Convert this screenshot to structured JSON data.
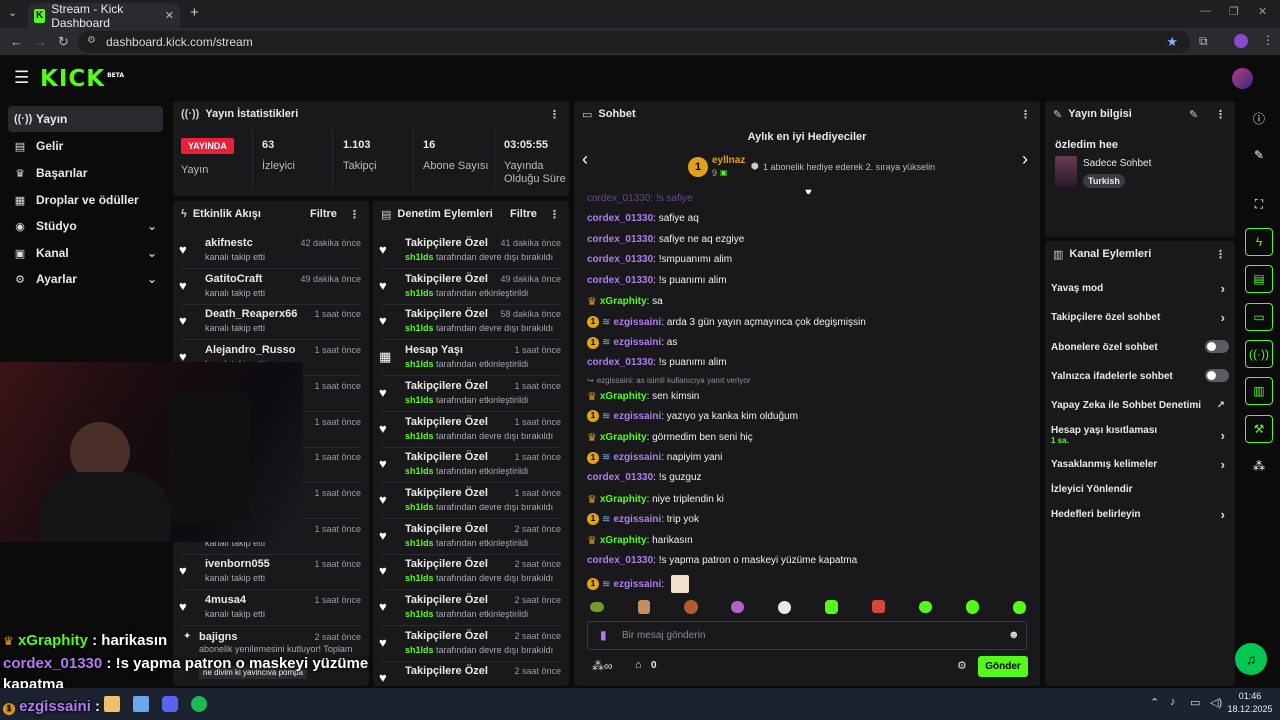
{
  "browser": {
    "tab_title": "Stream - Kick Dashboard",
    "url": "dashboard.kick.com/stream"
  },
  "header": {
    "logo": "KICK",
    "logo_badge": "BETA"
  },
  "sidebar": {
    "items": [
      {
        "label": "Yayın",
        "icon": "broadcast-icon"
      },
      {
        "label": "Gelir",
        "icon": "revenue-icon"
      },
      {
        "label": "Başarılar",
        "icon": "trophy-icon"
      },
      {
        "label": "Droplar ve ödüller",
        "icon": "gift-icon"
      },
      {
        "label": "Stüdyo",
        "icon": "studio-icon"
      },
      {
        "label": "Kanal",
        "icon": "channel-icon"
      },
      {
        "label": "Ayarlar",
        "icon": "gear-icon"
      }
    ]
  },
  "stats": {
    "title": "Yayın İstatistikleri",
    "live_badge": "YAYINDA",
    "live_label": "Yayın",
    "items": [
      {
        "value": "63",
        "label": "İzleyici"
      },
      {
        "value": "1.103",
        "label": "Takipçi"
      },
      {
        "value": "16",
        "label": "Abone Sayısı"
      },
      {
        "value": "03:05:55",
        "label": "Yayında Olduğu Süre"
      }
    ]
  },
  "activity": {
    "title": "Etkinlik Akışı",
    "filter": "Filtre",
    "items": [
      {
        "name": "akifnestc",
        "sub": "kanalı takip etti",
        "time": "42 dakika önce"
      },
      {
        "name": "GatitoCraft",
        "sub": "kanalı takip etti",
        "time": "49 dakika önce"
      },
      {
        "name": "Death_Reaperx66",
        "sub": "kanalı takip etti",
        "time": "1 saat önce"
      },
      {
        "name": "Alejandro_Russo",
        "sub": "kanalı takip etti",
        "time": "1 saat önce"
      },
      {
        "name": "",
        "sub": "",
        "time": "1 saat önce"
      },
      {
        "name": "",
        "sub": "",
        "time": "1 saat önce"
      },
      {
        "name": "",
        "sub": "",
        "time": "1 saat önce"
      },
      {
        "name": "",
        "sub": "",
        "time": "1 saat önce"
      },
      {
        "name": "",
        "sub": "kanalı takip etti",
        "time": "1 saat önce"
      },
      {
        "name": "ivenborn055",
        "sub": "kanalı takip etti",
        "time": "1 saat önce"
      },
      {
        "name": "4musa4",
        "sub": "kanalı takip etti",
        "time": "1 saat önce"
      }
    ],
    "last": {
      "name": "bajigns",
      "time": "2 saat önce",
      "sub": "abonelik yenilemesini kutluyor! Toplam",
      "msg": "ne divim ki yavincıva pompa"
    }
  },
  "moderation": {
    "title": "Denetim Eylemleri",
    "filter": "Filtre",
    "items": [
      {
        "action": "Takipçilere Özel",
        "mod": "sh1lds",
        "detail": "tarafından devre dışı bırakıldı",
        "time": "41 dakika önce"
      },
      {
        "action": "Takipçilere Özel",
        "mod": "sh1lds",
        "detail": "tarafından etkinleştirildi",
        "time": "49 dakika önce"
      },
      {
        "action": "Takipçilere Özel",
        "mod": "sh1lds",
        "detail": "tarafından devre dışı bırakıldı",
        "time": "58 dakika önce"
      },
      {
        "action": "Hesap Yaşı",
        "mod": "sh1lds",
        "detail": "tarafından etkinleştirildi",
        "time": "1 saat önce"
      },
      {
        "action": "Takipçilere Özel",
        "mod": "sh1lds",
        "detail": "tarafından etkinleştirildi",
        "time": "1 saat önce"
      },
      {
        "action": "Takipçilere Özel",
        "mod": "sh1lds",
        "detail": "tarafından devre dışı bırakıldı",
        "time": "1 saat önce"
      },
      {
        "action": "Takipçilere Özel",
        "mod": "sh1lds",
        "detail": "tarafından etkinleştirildi",
        "time": "1 saat önce"
      },
      {
        "action": "Takipçilere Özel",
        "mod": "sh1lds",
        "detail": "tarafından devre dışı bırakıldı",
        "time": "1 saat önce"
      },
      {
        "action": "Takipçilere Özel",
        "mod": "sh1lds",
        "detail": "tarafından etkinleştirildi",
        "time": "2 saat önce"
      },
      {
        "action": "Takipçilere Özel",
        "mod": "sh1lds",
        "detail": "tarafından devre dışı bırakıldı",
        "time": "2 saat önce"
      },
      {
        "action": "Takipçilere Özel",
        "mod": "sh1lds",
        "detail": "tarafından etkinleştirildi",
        "time": "2 saat önce"
      },
      {
        "action": "Takipçilere Özel",
        "mod": "sh1lds",
        "detail": "tarafından devre dışı bırakıldı",
        "time": "2 saat önce"
      },
      {
        "action": "Takipçilere Özel",
        "mod": "",
        "detail": "",
        "time": "2 saat önce"
      }
    ]
  },
  "chat": {
    "title": "Sohbet",
    "gifters_title": "Aylık en iyi Hediyeciler",
    "top_gifter": {
      "rank": "1",
      "name": "eyllnaz",
      "count": "9"
    },
    "gifter_note": "1 abonelik hediye ederek 2. sıraya yükselin",
    "messages": [
      {
        "user": "cordex_01330",
        "text": ": safiye aq",
        "type": "plain"
      },
      {
        "user": "cordex_01330",
        "text": ": safiye ne aq ezgiye",
        "type": "plain"
      },
      {
        "user": "cordex_01330",
        "text": ": !smpuanımı alim",
        "type": "plain"
      },
      {
        "user": "cordex_01330",
        "text": ": !s puanımı alim",
        "type": "plain"
      },
      {
        "user": "xGraphity",
        "text": ": sa",
        "type": "crown"
      },
      {
        "user": "ezgissaini",
        "text": ": arda 3 gün yayın açmayınca çok degişmişsin",
        "type": "sub"
      },
      {
        "user": "ezgissaini",
        "text": ": as",
        "type": "sub"
      },
      {
        "user": "cordex_01330",
        "text": ": !s puanımı alim",
        "type": "plain"
      },
      {
        "user": "xGraphity",
        "text": ": sen kimsin",
        "type": "crown",
        "reply": "ezgissaini: as isimli kullanıcıya yanıt veriyor"
      },
      {
        "user": "ezgissaini",
        "text": ": yazıyo ya kanka kim olduğum",
        "type": "sub"
      },
      {
        "user": "xGraphity",
        "text": ": görmedim ben seni hiç",
        "type": "crown"
      },
      {
        "user": "ezgissaini",
        "text": ": napiyim yani",
        "type": "sub"
      },
      {
        "user": "cordex_01330",
        "text": ": !s guzguz",
        "type": "plain"
      },
      {
        "user": "xGraphity",
        "text": ": niye triplendin ki",
        "type": "crown"
      },
      {
        "user": "ezgissaini",
        "text": ": trip yok",
        "type": "sub"
      },
      {
        "user": "xGraphity",
        "text": ": harikasın",
        "type": "crown"
      },
      {
        "user": "cordex_01330",
        "text": ": !s yapma patron o maskeyi yüzüme kapatma",
        "type": "plain"
      },
      {
        "user": "ezgissaini",
        "text": ":",
        "type": "sub"
      }
    ],
    "input_placeholder": "Bir mesaj gönderin",
    "points": "0",
    "send_label": "Gönder",
    "colors": {
      "cordex": "#b07cf0",
      "xgraphity": "#53fc18",
      "ezgi": "#b07cf0"
    }
  },
  "stream_info": {
    "title": "Yayın bilgisi",
    "stream_title": "özledim hee",
    "category": "Sadece Sohbet",
    "tag": "Turkish"
  },
  "channel_actions": {
    "title": "Kanal Eylemleri",
    "items": [
      {
        "label": "Yavaş mod",
        "control": "chevron"
      },
      {
        "label": "Takipçilere özel sohbet",
        "control": "chevron"
      },
      {
        "label": "Abonelere özel sohbet",
        "control": "toggle",
        "on": false
      },
      {
        "label": "Yalnızca ifadelerle sohbet",
        "control": "toggle",
        "on": false
      },
      {
        "label": "Yapay Zeka ile Sohbet Denetimi",
        "control": "external"
      },
      {
        "label": "Hesap yaşı kısıtlaması",
        "control": "chevron",
        "sub": "1 sa."
      },
      {
        "label": "Yasaklanmış kelimeler",
        "control": "chevron"
      },
      {
        "label": "İzleyici Yönlendir",
        "control": "none"
      },
      {
        "label": "Hedefleri belirleyin",
        "control": "chevron"
      }
    ]
  },
  "overlay_chat": [
    {
      "user": "xGraphity",
      "text": " : harikasın"
    },
    {
      "user": "cordex_01330",
      "text": " : !s yapma patron o maskeyi yüzüme"
    },
    {
      "user": "",
      "text": "kapatma"
    },
    {
      "user": "ezgissaini",
      "text": " :"
    }
  ],
  "taskbar": {
    "time": "01:46",
    "date": "18.12.2025"
  },
  "accent": "#53fc18"
}
